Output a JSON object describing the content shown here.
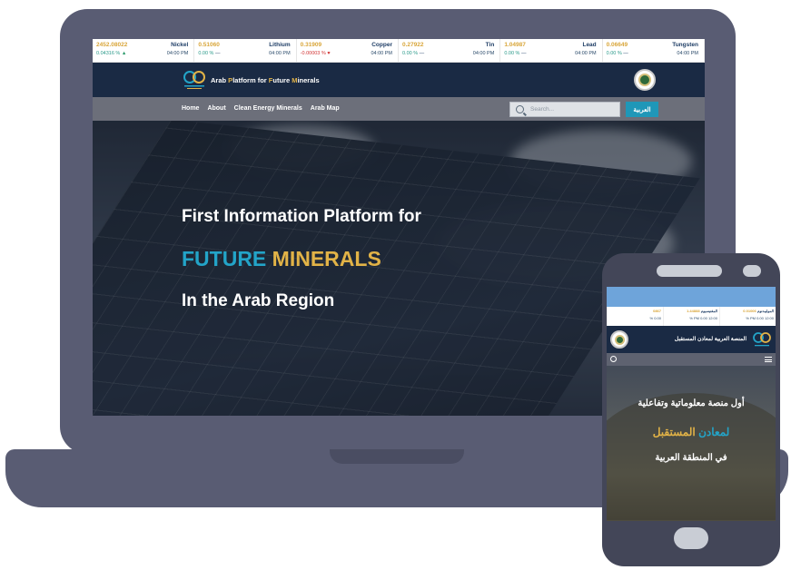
{
  "desktop": {
    "ticker": [
      {
        "price": "2452.08022",
        "name": "Nickel",
        "change": "0.04316 %",
        "direction": "up",
        "time": "04:00 PM"
      },
      {
        "price": "0.51060",
        "name": "Lithium",
        "change": "0.00 %",
        "direction": "flat",
        "time": "04:00 PM"
      },
      {
        "price": "0.31909",
        "name": "Copper",
        "change": "-0.00003 %",
        "direction": "down",
        "time": "04:00 PM"
      },
      {
        "price": "0.27922",
        "name": "Tin",
        "change": "0.00 %",
        "direction": "flat",
        "time": "04:00 PM"
      },
      {
        "price": "1.04987",
        "name": "Lead",
        "change": "0.00 %",
        "direction": "flat",
        "time": "04:00 PM"
      },
      {
        "price": "0.06649",
        "name": "Tungsten",
        "change": "0.00 %",
        "direction": "flat",
        "time": "04:00 PM"
      }
    ],
    "brand": {
      "part1": "Arab ",
      "part2": "P",
      "part3": "latform for ",
      "part4": "F",
      "part5": "uture ",
      "part6": "M",
      "part7": "inerals"
    },
    "nav": [
      "Home",
      "About",
      "Clean Energy Minerals",
      "Arab Map"
    ],
    "search_placeholder": "Search...",
    "lang_button": "العربية",
    "hero": {
      "line1": "First Information Platform for",
      "line2_blue": "FUTURE",
      "line2_gold": "MINERALS",
      "line3": "In the Arab Region"
    }
  },
  "mobile": {
    "ticker": [
      {
        "price": "0.01006",
        "name": "الموليبدنوم",
        "change": "0.00 %",
        "time": "12:00 PM"
      },
      {
        "price": "1.44888",
        "name": "المغنيسيوم",
        "change": "0.00 %",
        "time": "12:00 PM"
      },
      {
        "price": "0867",
        "name": "",
        "change": "0.00 %",
        "time": ""
      }
    ],
    "brand": "المنصة العربية لمعادن المستقبل",
    "hero": {
      "line1": "أول منصة معلوماتية وتفاعلية",
      "line2_blue": "لمعادن",
      "line2_gold": "المستقبل",
      "line3": "في المنطقة العربية"
    }
  },
  "colors": {
    "frame": "#595c73",
    "header": "#1a2a44",
    "accent_blue": "#23a4c8",
    "accent_gold": "#e2b347",
    "lang_button": "#1f97b8"
  },
  "icons": {
    "up": "triangle-up-icon",
    "flat": "dash-icon",
    "down": "heart-down-icon",
    "search": "search-icon",
    "menu": "hamburger-menu-icon"
  }
}
